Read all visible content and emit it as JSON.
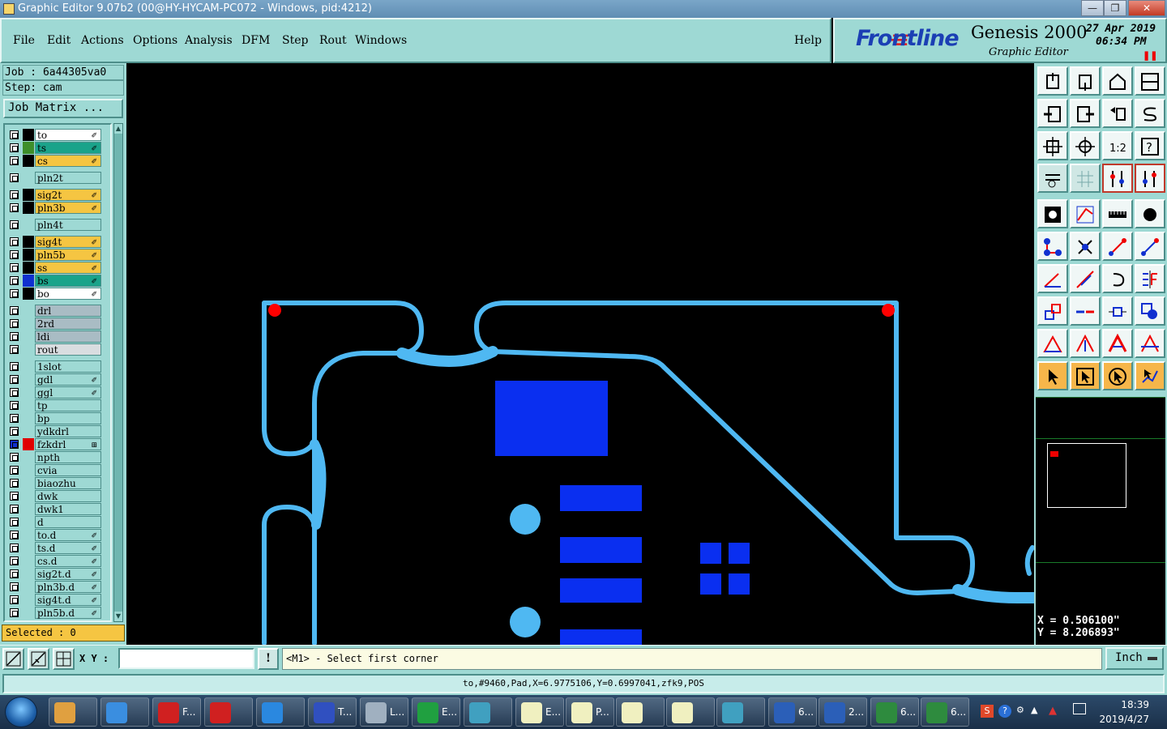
{
  "window": {
    "title": "Graphic Editor 9.07b2 (00@HY-HYCAM-PC072 - Windows, pid:4212)",
    "minimize": "—",
    "maximize": "❐",
    "close": "✕"
  },
  "menu": [
    "File",
    "Edit",
    "Actions",
    "Options",
    "Analysis",
    "DFM",
    "Step",
    "Rout",
    "Windows"
  ],
  "menu_help": "Help",
  "brand": {
    "frontline": "Frontline",
    "product": "Genesis 2000",
    "subtitle": "Graphic Editor",
    "date": "27 Apr 2019",
    "time": "06:34 PM"
  },
  "job": {
    "job_line": "Job : 6a44305va0",
    "step_line": "Step: cam",
    "matrix_button": "Job Matrix ..."
  },
  "layers": [
    {
      "name": "to",
      "color": "#ffffff",
      "swatch": "#000000",
      "flag": "✐"
    },
    {
      "name": "ts",
      "color": "#1aa38a",
      "swatch": "#3e8e2a",
      "flag": "✐"
    },
    {
      "name": "cs",
      "color": "#f5c542",
      "swatch": "#000000",
      "flag": "✐"
    },
    {
      "name": "pln2t",
      "color": "#9ed9d4",
      "swatch": "",
      "flag": ""
    },
    {
      "name": "sig2t",
      "color": "#f5c542",
      "swatch": "#000000",
      "flag": "✐"
    },
    {
      "name": "pln3b",
      "color": "#f5c542",
      "swatch": "#000000",
      "flag": "✐"
    },
    {
      "name": "pln4t",
      "color": "#9ed9d4",
      "swatch": "",
      "flag": ""
    },
    {
      "name": "sig4t",
      "color": "#f5c542",
      "swatch": "#000000",
      "flag": "✐"
    },
    {
      "name": "pln5b",
      "color": "#f5c542",
      "swatch": "#000000",
      "flag": "✐"
    },
    {
      "name": "ss",
      "color": "#f5c542",
      "swatch": "#000000",
      "flag": "✐"
    },
    {
      "name": "bs",
      "color": "#1aa38a",
      "swatch": "#1030d0",
      "flag": "✐"
    },
    {
      "name": "bo",
      "color": "#ffffff",
      "swatch": "#000000",
      "flag": "✐"
    },
    {
      "name": "drl",
      "color": "#a9bcc4",
      "swatch": "",
      "flag": ""
    },
    {
      "name": "2rd",
      "color": "#a9bcc4",
      "swatch": "",
      "flag": ""
    },
    {
      "name": "ldi",
      "color": "#a9bcc4",
      "swatch": "",
      "flag": ""
    },
    {
      "name": "rout",
      "color": "#d9dde0",
      "swatch": "",
      "flag": ""
    },
    {
      "name": "1slot",
      "color": "#9ed9d4",
      "swatch": "",
      "flag": ""
    },
    {
      "name": "gdl",
      "color": "#9ed9d4",
      "swatch": "",
      "flag": "✐"
    },
    {
      "name": "ggl",
      "color": "#9ed9d4",
      "swatch": "",
      "flag": "✐"
    },
    {
      "name": "tp",
      "color": "#9ed9d4",
      "swatch": "",
      "flag": ""
    },
    {
      "name": "bp",
      "color": "#9ed9d4",
      "swatch": "",
      "flag": ""
    },
    {
      "name": "ydkdrl",
      "color": "#9ed9d4",
      "swatch": "",
      "flag": ""
    },
    {
      "name": "fzkdrl",
      "color": "#9ed9d4",
      "swatch": "#e00000",
      "flag": "⊞"
    },
    {
      "name": "npth",
      "color": "#9ed9d4",
      "swatch": "",
      "flag": ""
    },
    {
      "name": "cvia",
      "color": "#9ed9d4",
      "swatch": "",
      "flag": ""
    },
    {
      "name": "biaozhu",
      "color": "#9ed9d4",
      "swatch": "",
      "flag": ""
    },
    {
      "name": "dwk",
      "color": "#9ed9d4",
      "swatch": "",
      "flag": ""
    },
    {
      "name": "dwk1",
      "color": "#9ed9d4",
      "swatch": "",
      "flag": ""
    },
    {
      "name": "d",
      "color": "#9ed9d4",
      "swatch": "",
      "flag": ""
    },
    {
      "name": "to.d",
      "color": "#9ed9d4",
      "swatch": "",
      "flag": "✐"
    },
    {
      "name": "ts.d",
      "color": "#9ed9d4",
      "swatch": "",
      "flag": "✐"
    },
    {
      "name": "cs.d",
      "color": "#9ed9d4",
      "swatch": "",
      "flag": "✐"
    },
    {
      "name": "sig2t.d",
      "color": "#9ed9d4",
      "swatch": "",
      "flag": "✐"
    },
    {
      "name": "pln3b.d",
      "color": "#9ed9d4",
      "swatch": "",
      "flag": "✐"
    },
    {
      "name": "sig4t.d",
      "color": "#9ed9d4",
      "swatch": "",
      "flag": "✐"
    },
    {
      "name": "pln5b.d",
      "color": "#9ed9d4",
      "swatch": "",
      "flag": "✐"
    }
  ],
  "selected": "Selected : 0",
  "coords": {
    "x": "X = 0.506100\"",
    "y": "Y = 8.206893\""
  },
  "command": {
    "xy_label": "X Y :",
    "xy_value": "",
    "bang": "!",
    "prompt": "<M1> - Select first corner",
    "unit": "Inch"
  },
  "status": "to,#9460,Pad,X=6.9775106,Y=0.6997041,zfk9,POS",
  "colors": {
    "trace": "#4fb8f2",
    "pad_blue": "#0a2ff0",
    "marker_red": "#ff0000",
    "panel": "#9ed9d4"
  },
  "taskbar": {
    "items": [
      {
        "label": "",
        "icon": "shell-icon"
      },
      {
        "label": "",
        "icon": "bird-icon"
      },
      {
        "label": "F...",
        "icon": "g-logo-icon"
      },
      {
        "label": "",
        "icon": "g-logo-icon"
      },
      {
        "label": "",
        "icon": "ie-icon"
      },
      {
        "label": "T...",
        "icon": "floppy-icon"
      },
      {
        "label": "L...",
        "icon": "scanner-icon"
      },
      {
        "label": "E...",
        "icon": "frontline-f-icon"
      },
      {
        "label": "",
        "icon": "eye-icon"
      },
      {
        "label": "E...",
        "icon": "x-window-icon"
      },
      {
        "label": "P...",
        "icon": "x-window-icon"
      },
      {
        "label": "",
        "icon": "x-window-icon"
      },
      {
        "label": "",
        "icon": "x-window-icon"
      },
      {
        "label": "",
        "icon": "eye-icon"
      },
      {
        "label": "6...",
        "icon": "word-icon"
      },
      {
        "label": "2...",
        "icon": "word-icon"
      },
      {
        "label": "6...",
        "icon": "excel-icon"
      },
      {
        "label": "6...",
        "icon": "excel-icon"
      }
    ],
    "time": "18:39",
    "date": "2019/4/27"
  }
}
